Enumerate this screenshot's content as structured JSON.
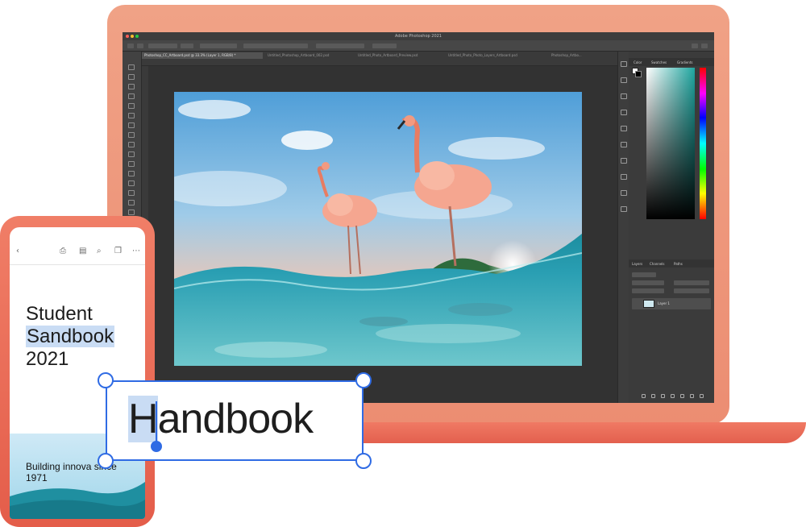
{
  "photoshop": {
    "window_title": "Adobe Photoshop 2021",
    "document_tabs": [
      "Photoshop_CC_Artboard.psd @ 33.3% (Layer 1, RGB/8) *",
      "Untitled_Photoshop_Artboard_002.psd",
      "Untitled_Photo_Artboard_Preview.psd",
      "Untitled_Photo_Photo_Layers_Artboard.psd",
      "Photoshop_Artbo..."
    ],
    "panel_tabs_top": [
      "Color",
      "Swatches",
      "Gradients"
    ],
    "panel_tabs_layers": [
      "Layers",
      "Channels",
      "Paths"
    ],
    "layer_name": "Layer 1",
    "colors": {
      "lid": "#ec8d72",
      "base": "#e3604e",
      "ui_dark": "#323232",
      "accent": "#2f6be4"
    }
  },
  "phone": {
    "toolbar_icons": [
      "back-icon",
      "share-icon",
      "document-icon",
      "search-icon",
      "copy-icon",
      "more-icon"
    ],
    "title_line1": "Student",
    "title_line2": "Sandbook",
    "title_line3": "2021",
    "image_caption": "Building innova since 1971"
  },
  "edit_overlay": {
    "text_first_letter": "H",
    "text_rest": "andbook"
  }
}
